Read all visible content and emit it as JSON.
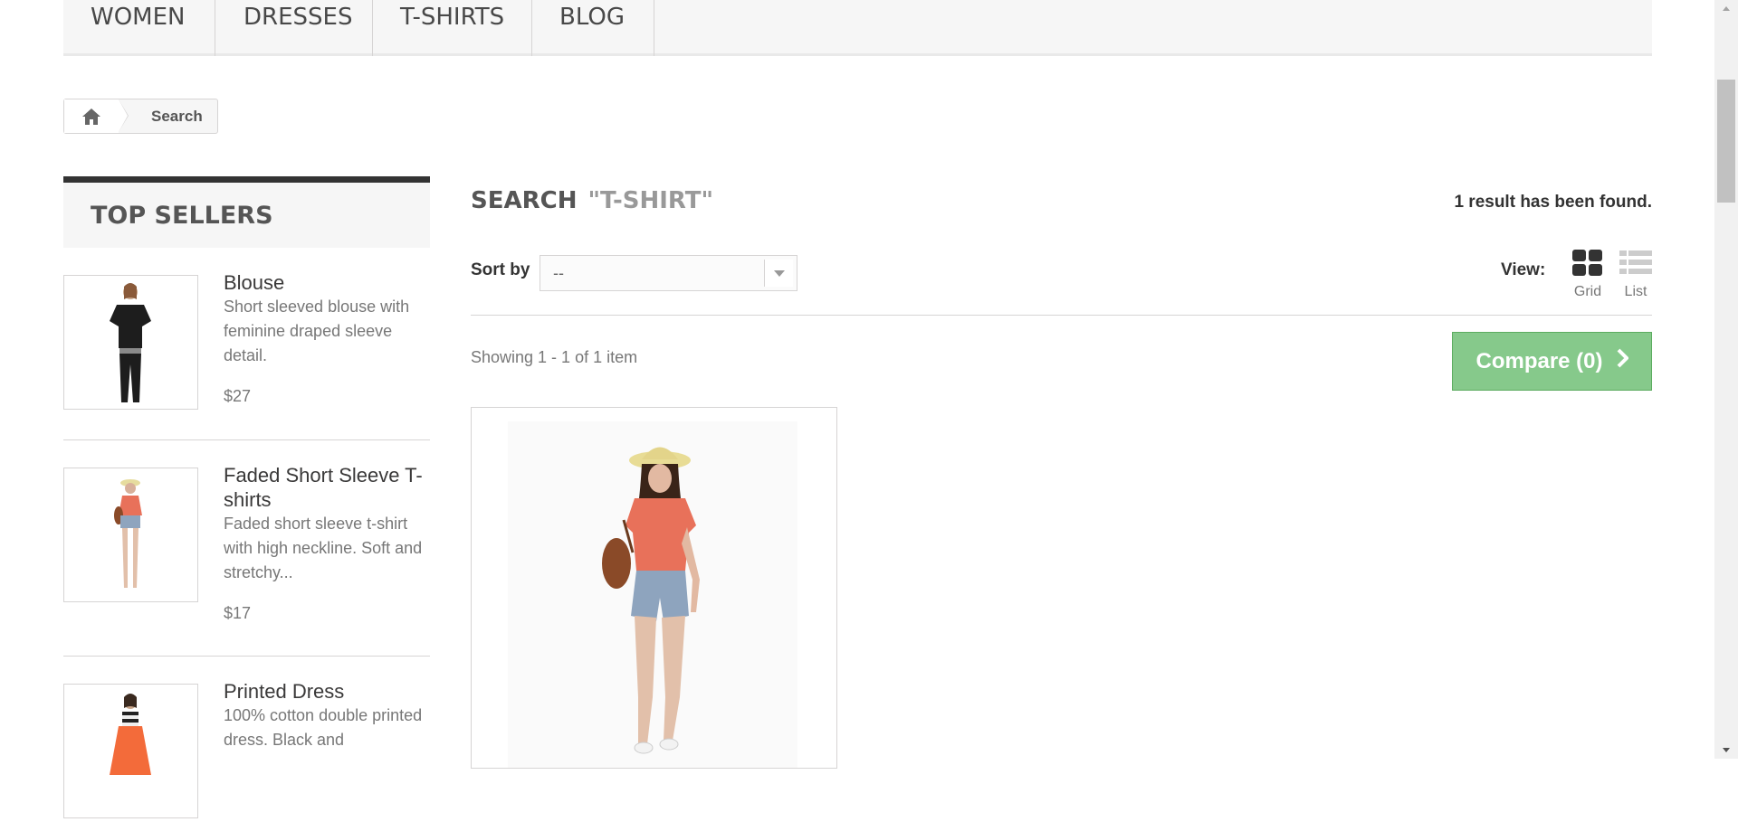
{
  "nav": {
    "items": [
      "WOMEN",
      "DRESSES",
      "T-SHIRTS",
      "BLOG"
    ]
  },
  "breadcrumb": {
    "home_icon": "home-icon",
    "current": "Search"
  },
  "sidebar": {
    "title": "TOP SELLERS",
    "products": [
      {
        "name": "Blouse",
        "description": "Short sleeved blouse with feminine draped sleeve detail.",
        "price": "$27"
      },
      {
        "name": "Faded Short Sleeve T-shirts",
        "description": "Faded short sleeve t-shirt with high neckline. Soft and stretchy...",
        "price": "$17"
      },
      {
        "name": "Printed Dress",
        "description": "100% cotton double printed dress. Black and",
        "price": ""
      }
    ]
  },
  "main": {
    "heading": "SEARCH",
    "query": "\"T-SHIRT\"",
    "result_count": "1 result has been found.",
    "sort_label": "Sort by",
    "sort_value": "--",
    "view_label": "View:",
    "view_grid": "Grid",
    "view_list": "List",
    "showing": "Showing 1 - 1 of 1 item",
    "compare": "Compare (0)"
  },
  "colors": {
    "compare_bg": "#86c98b",
    "dark": "#333333"
  }
}
